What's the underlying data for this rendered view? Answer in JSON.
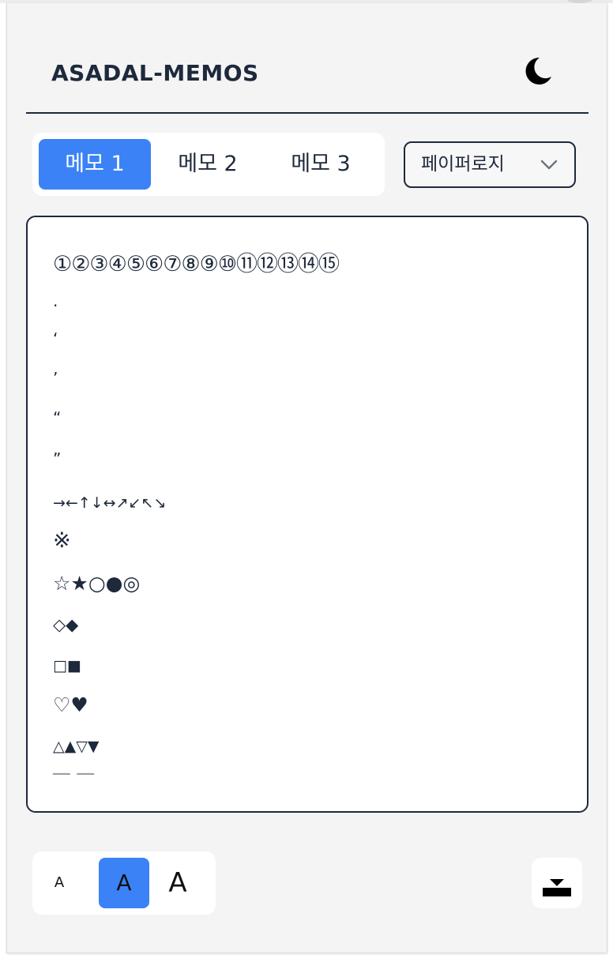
{
  "header": {
    "title": "ASADAL-MEMOS",
    "theme_icon": "moon-icon"
  },
  "tabs": [
    {
      "label": "메모 1",
      "active": true
    },
    {
      "label": "메모 2",
      "active": false
    },
    {
      "label": "메모 3",
      "active": false
    }
  ],
  "paper_select": {
    "value": "페이퍼로지"
  },
  "memo": {
    "lines": [
      "①②③④⑤⑥⑦⑧⑨⑩⑪⑫⑬⑭⑮",
      ".",
      "‘",
      "’",
      "“",
      "”",
      "→←↑↓↔↗↙↖↘",
      "※",
      "☆★○●◎",
      "◇◆",
      "□■",
      "♡♥",
      "△▲▽▼"
    ]
  },
  "font_size": {
    "options": [
      {
        "label": "A",
        "size": "small",
        "active": false
      },
      {
        "label": "A",
        "size": "medium",
        "active": true
      },
      {
        "label": "A",
        "size": "large",
        "active": false
      }
    ]
  },
  "colors": {
    "accent": "#3b82f6",
    "ink": "#1e293b",
    "background": "#f4f4f5"
  },
  "save_icon": "download-icon"
}
